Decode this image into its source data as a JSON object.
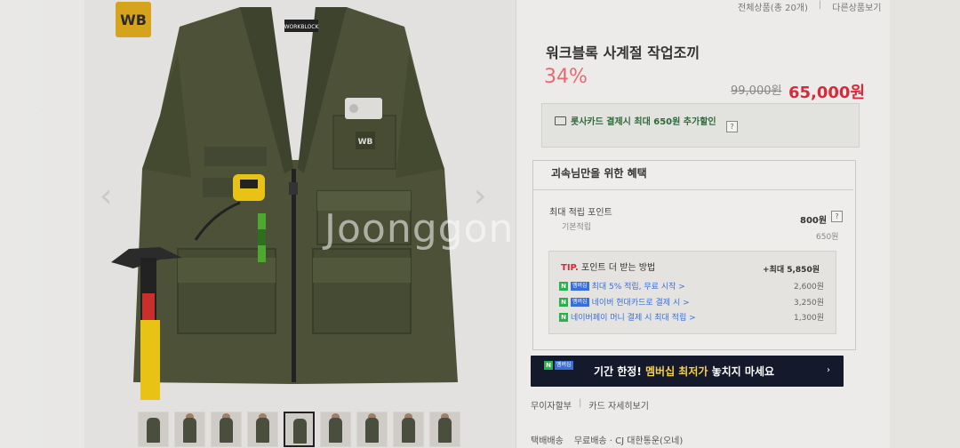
{
  "brand_logo_text": "WB",
  "top_links": {
    "all_products": "전체상품(총 20개)",
    "other_products": "다른상품보기"
  },
  "product": {
    "title": "워크블록 사계절 작업조끼",
    "discount": "34%",
    "original_price": "99,000원",
    "sale_price": "65,000원"
  },
  "card_promo": {
    "text": "롯사카드 결제시 최대 650원 추가할인",
    "help": "?"
  },
  "benefits": {
    "title": "괴속님만을 위한 혜택",
    "max_points_label": "최대 적립 포인트",
    "max_points_value": "800원",
    "base_label": "기본적립",
    "base_value": "650원",
    "help": "?",
    "tip": {
      "tip_label": "TIP.",
      "heading": "포인트 더 받는 방법",
      "total": "+최대 5,850원",
      "rows": [
        {
          "badge_n": "N",
          "badge_m": "멤버십",
          "text": "최대 5% 적립, 무료 시작 >",
          "value": "2,600원"
        },
        {
          "badge_n": "N",
          "badge_m": "멤버십",
          "text": "네이버 현대카드로 결제 시 >",
          "value": "3,250원"
        },
        {
          "badge_n": "N",
          "badge_m": "",
          "text": "네이버페이 머니 결제 시 최대 적립 >",
          "value": "1,300원"
        }
      ]
    }
  },
  "banner": {
    "badge_n": "N",
    "badge_m": "멤버십",
    "text_before": "기간 한정!",
    "text_highlight": " 멤버십 최저가",
    "text_after": " 놓치지 마세요",
    "arrow": "›"
  },
  "links": {
    "no_interest": "무이자할부",
    "card_benefit": "카드 자세히보기"
  },
  "delivery": {
    "label": "택배배송",
    "info": "무료배송 · CJ 대한통운(오네)"
  },
  "nav": {
    "prev": "‹",
    "next": "›"
  },
  "vest_labels": {
    "chest_logo": "WB",
    "badge_text": "WORKBLOCK"
  },
  "watermark": "Joonggonara",
  "colors": {
    "vest": "#4c5137",
    "vest_dark": "#3a3f2a",
    "sale_red": "#d62b3a",
    "discount_pink": "#e46a74",
    "banner_bg": "#141a2c",
    "tape_yellow": "#e8c315"
  },
  "thumbnails_count": 9
}
